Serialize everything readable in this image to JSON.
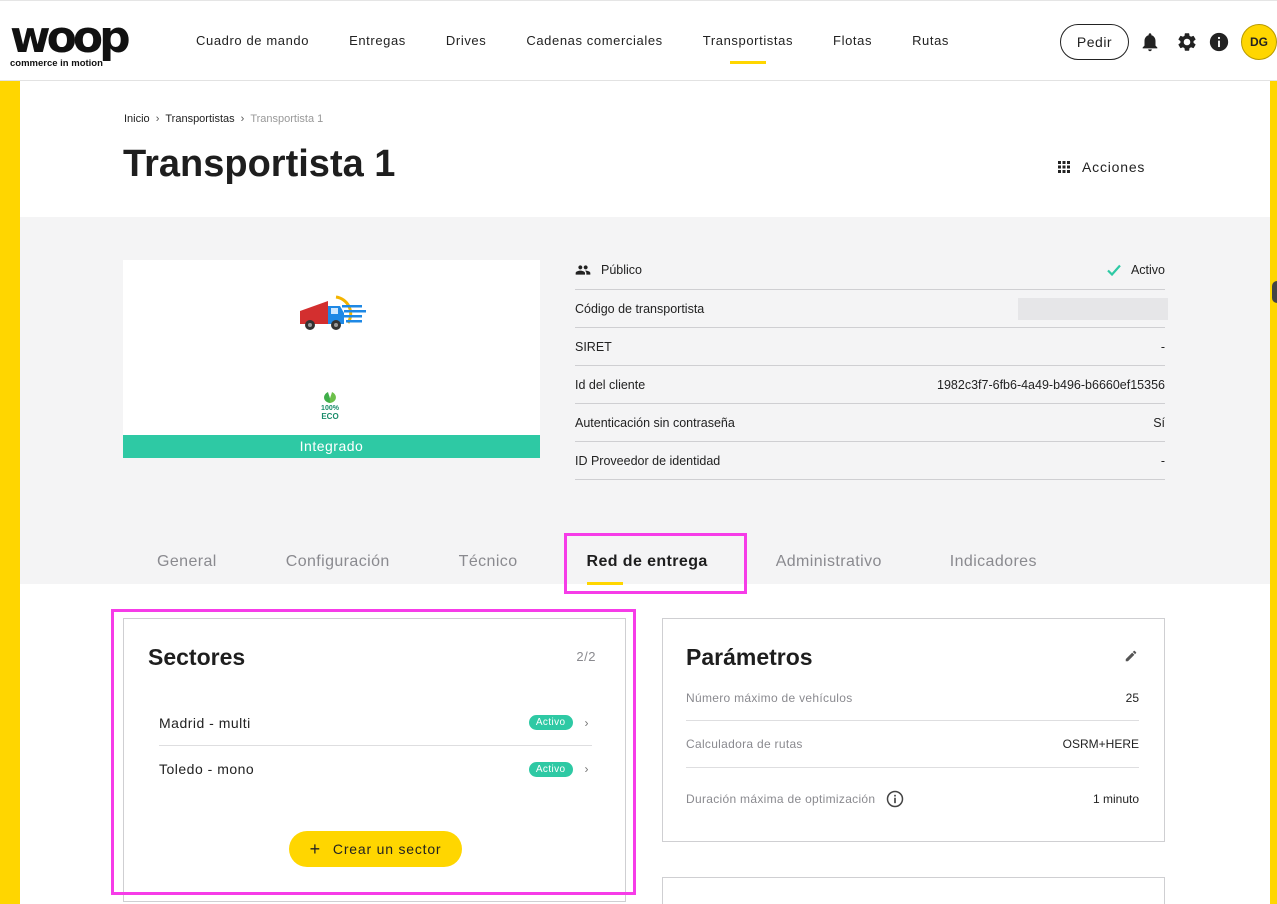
{
  "brand": {
    "name": "woop",
    "tagline": "commerce in motion",
    "accent": "#ffd600",
    "success": "#2ec9a4"
  },
  "nav": {
    "items": [
      {
        "label": "Cuadro de mando"
      },
      {
        "label": "Entregas"
      },
      {
        "label": "Drives"
      },
      {
        "label": "Cadenas comerciales"
      },
      {
        "label": "Transportistas",
        "active": true
      },
      {
        "label": "Flotas"
      },
      {
        "label": "Rutas"
      }
    ],
    "pedir_label": "Pedir",
    "avatar_initials": "DG",
    "icons": [
      "bell-icon",
      "gear-icon",
      "info-icon"
    ]
  },
  "breadcrumb": {
    "home": "Inicio",
    "parent": "Transportistas",
    "current": "Transportista 1"
  },
  "page": {
    "title": "Transportista 1",
    "actions_label": "Acciones"
  },
  "carrier": {
    "status_label": "Integrado",
    "eco_line1": "100%",
    "eco_line2": "ECO",
    "visibility": "Público",
    "state": "Activo",
    "fields": [
      {
        "label": "Código de transportista",
        "value": ""
      },
      {
        "label": "SIRET",
        "value": "-"
      },
      {
        "label": "Id del cliente",
        "value": "1982c3f7-6fb6-4a49-b496-b6660ef15356"
      },
      {
        "label": "Autenticación sin contraseña",
        "value": "Sí"
      },
      {
        "label": "ID Proveedor de identidad",
        "value": "-"
      }
    ]
  },
  "tabs": [
    {
      "label": "General"
    },
    {
      "label": "Configuración"
    },
    {
      "label": "Técnico"
    },
    {
      "label": "Red de entrega",
      "active": true
    },
    {
      "label": "Administrativo"
    },
    {
      "label": "Indicadores"
    }
  ],
  "sectors": {
    "title": "Sectores",
    "count": "2/2",
    "items": [
      {
        "name": "Madrid - multi",
        "status": "Activo"
      },
      {
        "name": "Toledo - mono",
        "status": "Activo"
      }
    ],
    "create_label": "Crear un sector"
  },
  "params": {
    "title": "Parámetros",
    "rows": [
      {
        "label": "Número máximo de vehículos",
        "value": "25"
      },
      {
        "label": "Calculadora de rutas",
        "value": "OSRM+HERE"
      },
      {
        "label": "Duración máxima de optimización",
        "value": "1 minuto"
      }
    ]
  }
}
